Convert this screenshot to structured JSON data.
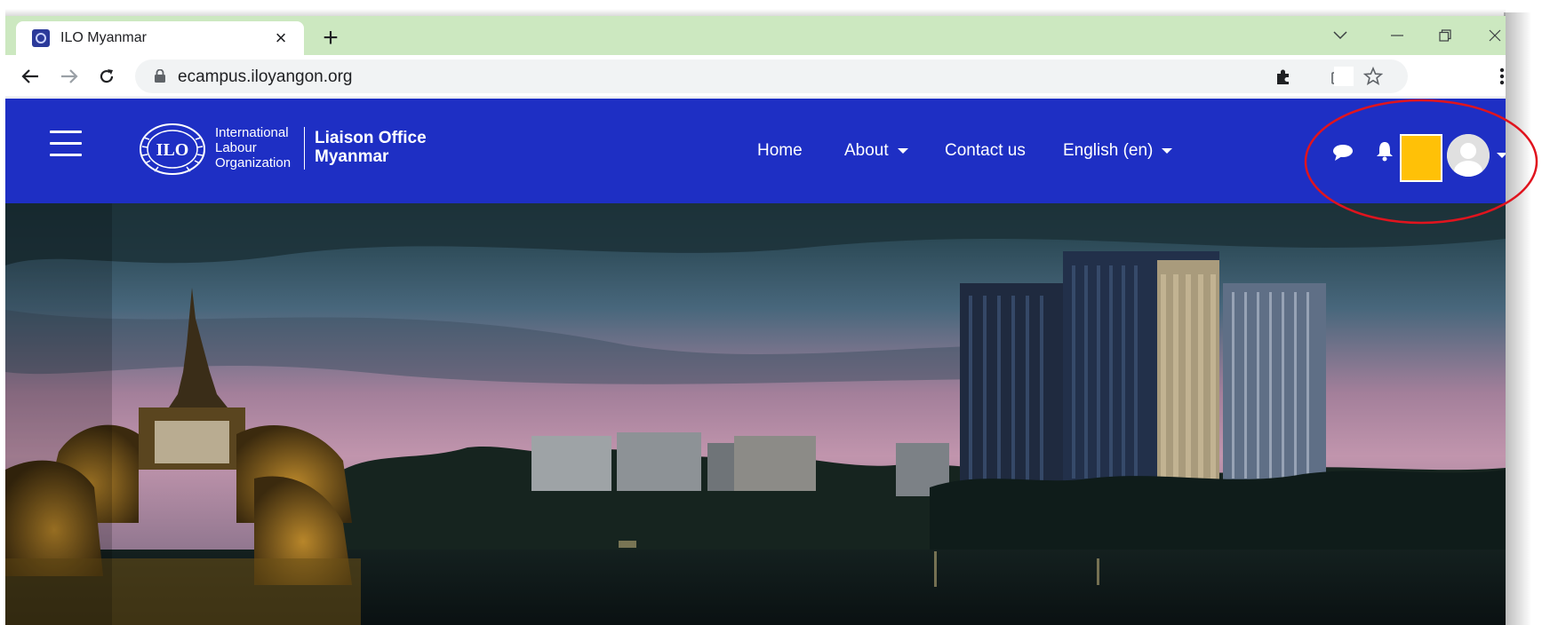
{
  "browser": {
    "tab_title": "ILO Myanmar",
    "tab_close": "×",
    "new_tab": "+",
    "url": "ecampus.iloyangon.org"
  },
  "site": {
    "logo": {
      "line1": "International",
      "line2": "Labour",
      "line3": "Organization",
      "office_line1": "Liaison Office",
      "office_line2": "Myanmar"
    },
    "nav": {
      "home": "Home",
      "about": "About",
      "contact": "Contact us",
      "language": "English ‎(en)‎"
    },
    "colors": {
      "header_bg": "#1e2fc4",
      "tabstrip_bg": "#cce8c0",
      "highlight_box": "#ffc107",
      "annotation_stroke": "#e0141e"
    },
    "icons": [
      "hamburger-icon",
      "chat-icon",
      "bell-icon",
      "avatar-icon"
    ]
  }
}
